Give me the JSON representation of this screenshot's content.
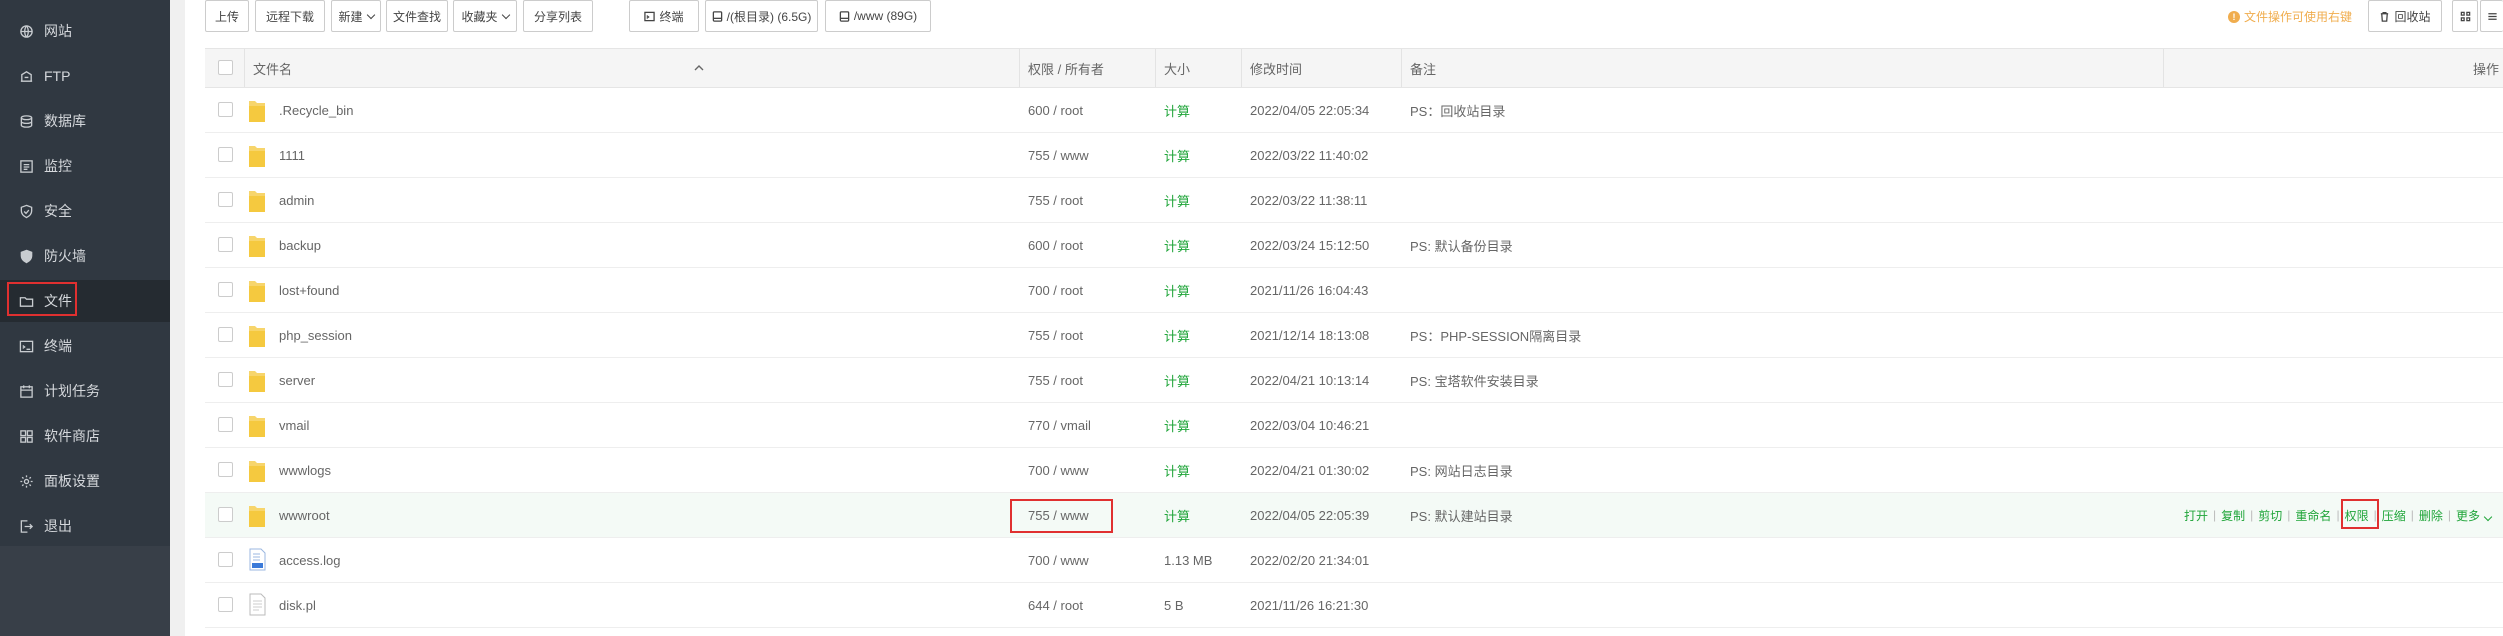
{
  "sidebar": {
    "items": [
      {
        "label": "网站",
        "icon": "globe-icon"
      },
      {
        "label": "FTP",
        "icon": "ftp-icon"
      },
      {
        "label": "数据库",
        "icon": "database-icon"
      },
      {
        "label": "监控",
        "icon": "monitor-icon"
      },
      {
        "label": "安全",
        "icon": "shield-icon"
      },
      {
        "label": "防火墙",
        "icon": "firewall-icon"
      },
      {
        "label": "文件",
        "icon": "folder-icon"
      },
      {
        "label": "终端",
        "icon": "terminal-icon"
      },
      {
        "label": "计划任务",
        "icon": "calendar-icon"
      },
      {
        "label": "软件商店",
        "icon": "grid-icon"
      },
      {
        "label": "面板设置",
        "icon": "gear-icon"
      },
      {
        "label": "退出",
        "icon": "logout-icon"
      }
    ],
    "active_index": 6
  },
  "toolbar": {
    "upload": "上传",
    "remote_download": "远程下载",
    "new": "新建",
    "file_search": "文件查找",
    "favorites": "收藏夹",
    "share_list": "分享列表",
    "terminal": "终端",
    "disk_root": "/(根目录) (6.5G)",
    "disk_www": "/www (89G)",
    "tip": "文件操作可使用右键",
    "recycle_bin": "回收站"
  },
  "table": {
    "headers": {
      "name": "文件名",
      "perm": "权限 / 所有者",
      "size": "大小",
      "mtime": "修改时间",
      "note": "备注",
      "ops": "操作"
    },
    "rows": [
      {
        "name": ".Recycle_bin",
        "type": "folder",
        "perm": "600 / root",
        "size": "计算",
        "mtime": "2022/04/05 22:05:34",
        "note": "PS：回收站目录"
      },
      {
        "name": "1111",
        "type": "folder",
        "perm": "755 / www",
        "size": "计算",
        "mtime": "2022/03/22 11:40:02",
        "note": ""
      },
      {
        "name": "admin",
        "type": "folder",
        "perm": "755 / root",
        "size": "计算",
        "mtime": "2022/03/22 11:38:11",
        "note": ""
      },
      {
        "name": "backup",
        "type": "folder",
        "perm": "600 / root",
        "size": "计算",
        "mtime": "2022/03/24 15:12:50",
        "note": "PS: 默认备份目录"
      },
      {
        "name": "lost+found",
        "type": "folder",
        "perm": "700 / root",
        "size": "计算",
        "mtime": "2021/11/26 16:04:43",
        "note": ""
      },
      {
        "name": "php_session",
        "type": "folder",
        "perm": "755 / root",
        "size": "计算",
        "mtime": "2021/12/14 18:13:08",
        "note": "PS：PHP-SESSION隔离目录"
      },
      {
        "name": "server",
        "type": "folder",
        "perm": "755 / root",
        "size": "计算",
        "mtime": "2022/04/21 10:13:14",
        "note": "PS: 宝塔软件安装目录"
      },
      {
        "name": "vmail",
        "type": "folder",
        "perm": "770 / vmail",
        "size": "计算",
        "mtime": "2022/03/04 10:46:21",
        "note": ""
      },
      {
        "name": "wwwlogs",
        "type": "folder",
        "perm": "700 / www",
        "size": "计算",
        "mtime": "2022/04/21 01:30:02",
        "note": "PS: 网站日志目录"
      },
      {
        "name": "wwwroot",
        "type": "folder",
        "perm": "755 / www",
        "size": "计算",
        "mtime": "2022/04/05 22:05:39",
        "note": "PS: 默认建站目录"
      },
      {
        "name": "access.log",
        "type": "log",
        "perm": "700 / www",
        "size": "1.13 MB",
        "mtime": "2022/02/20 21:34:01",
        "note": ""
      },
      {
        "name": "disk.pl",
        "type": "file",
        "perm": "644 / root",
        "size": "5 B",
        "mtime": "2021/11/26 16:21:30",
        "note": ""
      }
    ],
    "row_ops": [
      "打开",
      "复制",
      "剪切",
      "重命名",
      "权限",
      "压缩",
      "删除",
      "更多"
    ]
  }
}
